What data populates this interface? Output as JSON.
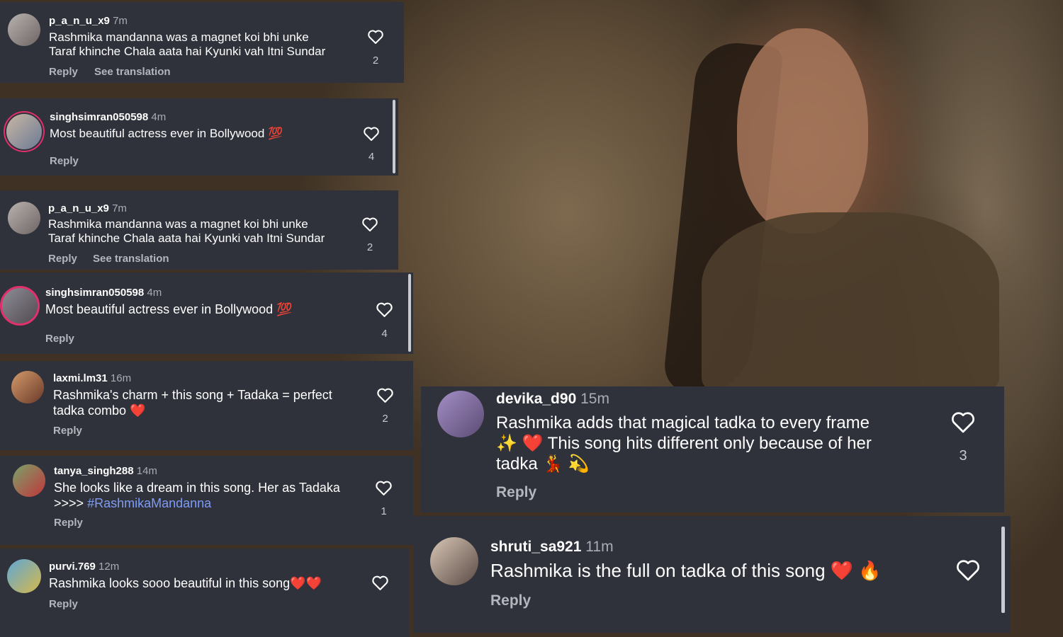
{
  "comments": [
    {
      "username": "p_a_n_u_x9",
      "time": "7m",
      "lines": [
        "Rashmika mandanna was a magnet koi bhi unke",
        "Taraf khinche Chala aata hai Kyunki vah Itni Sundar"
      ],
      "likes": "2",
      "reply": "Reply",
      "translate": "See translation"
    },
    {
      "username": "singhsimran050598",
      "time": "4m",
      "lines": [
        "Most beautiful actress ever in Bollywood 💯"
      ],
      "likes": "4",
      "reply": "Reply"
    },
    {
      "username": "p_a_n_u_x9",
      "time": "7m",
      "lines": [
        "Rashmika mandanna was a magnet koi bhi unke",
        "Taraf khinche Chala aata hai Kyunki vah Itni Sundar"
      ],
      "likes": "2",
      "reply": "Reply",
      "translate": "See translation"
    },
    {
      "username": "singhsimran050598",
      "time": "4m",
      "lines": [
        "Most beautiful actress ever in Bollywood 💯"
      ],
      "likes": "4",
      "reply": "Reply"
    },
    {
      "username": "laxmi.lm31",
      "time": "16m",
      "lines": [
        "Rashmika's charm + this song + Tadaka = perfect",
        "tadka combo ❤️"
      ],
      "likes": "2",
      "reply": "Reply"
    },
    {
      "username": "tanya_singh288",
      "time": "14m",
      "line1": "She looks like a dream in this song. Her as Tadaka",
      "line2_prefix": ">>>> ",
      "hashtag": "#RashmikaMandanna",
      "likes": "1",
      "reply": "Reply"
    },
    {
      "username": "purvi.769",
      "time": "12m",
      "lines": [
        "Rashmika looks sooo beautiful in this song❤️❤️"
      ],
      "reply": "Reply"
    },
    {
      "username": "devika_d90",
      "time": "15m",
      "lines": [
        "Rashmika adds that magical tadka to every frame",
        "✨ ❤️ This song hits different only because of her",
        "tadka 💃 💫"
      ],
      "likes": "3",
      "reply": "Reply"
    },
    {
      "username": "shruti_sa921",
      "time": "11m",
      "lines": [
        "Rashmika is the full on tadka of this song ❤️ 🔥"
      ],
      "reply": "Reply"
    }
  ],
  "icons": {
    "like": "heart-outline-icon",
    "avatar": "user-avatar"
  },
  "colors": {
    "card": "#2f323b",
    "text": "#ffffff",
    "muted": "#a9acb3",
    "hashtag": "#7f9cf5"
  }
}
